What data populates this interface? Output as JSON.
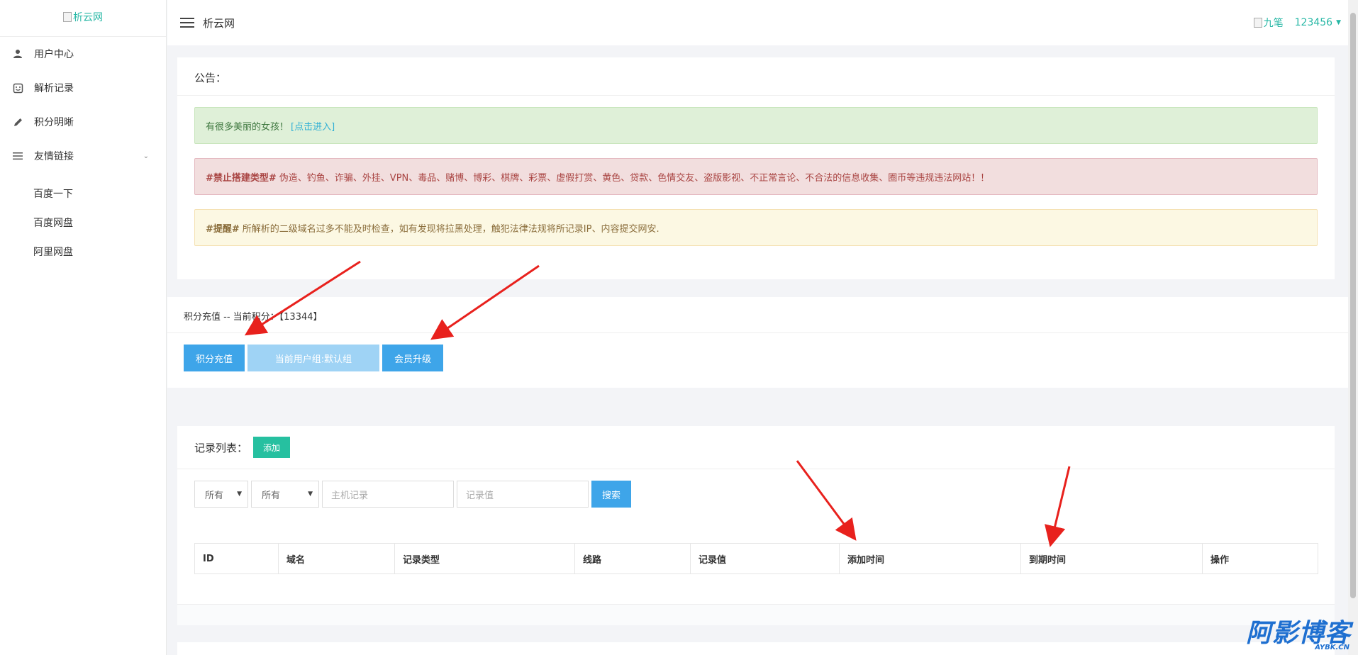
{
  "app": {
    "logo_alt": "析云网",
    "site_name": "析云网",
    "user_avatar_alt": "九笔",
    "username": "123456"
  },
  "sidebar": {
    "items": [
      {
        "label": "用户中心",
        "icon": "user-icon"
      },
      {
        "label": "解析记录",
        "icon": "note-icon"
      },
      {
        "label": "积分明晰",
        "icon": "pencil-icon"
      },
      {
        "label": "友情链接",
        "icon": "list-icon"
      }
    ],
    "links": [
      "百度一下",
      "百度网盘",
      "阿里网盘"
    ]
  },
  "notice": {
    "title": "公告：",
    "success_text": "有很多美丽的女孩！",
    "success_link": "[点击进入]",
    "danger_bold": "#禁止搭建类型#",
    "danger_text": "伪造、钓鱼、诈骗、外挂、VPN、毒品、赌博、博彩、棋牌、彩票、虚假打赏、黄色、贷款、色情交友、盗版影视、不正常言论、不合法的信息收集、圈币等违规违法网站！！",
    "warning_bold": "#提醒#",
    "warning_text": "所解析的二级域名过多不能及时检查，如有发现将拉黑处理，触犯法律法规将所记录IP、内容提交网安."
  },
  "points": {
    "header": "积分充值 -- 当前积分：【13344】",
    "recharge_button": "积分充值",
    "group_button": "当前用户组:默认组",
    "upgrade_button": "会员升级"
  },
  "records": {
    "title": "记录列表：",
    "add_button": "添加",
    "filter1": "所有",
    "filter2": "所有",
    "host_placeholder": "主机记录",
    "value_placeholder": "记录值",
    "search_button": "搜索",
    "columns": [
      "ID",
      "域名",
      "记录类型",
      "线路",
      "记录值",
      "添加时间",
      "到期时间",
      "操作"
    ]
  },
  "watermark": {
    "main": "阿影博客",
    "sub": "AYBK.CN"
  },
  "colors": {
    "accent": "#26b7a5",
    "primary": "#3ea5e9",
    "annotation_arrow": "#e8211d"
  }
}
